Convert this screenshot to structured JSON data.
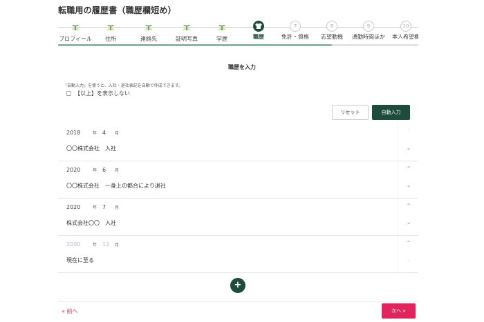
{
  "header": {
    "title": "転職用の履歴書（職歴欄短め）"
  },
  "stepper": {
    "progress": 0.76,
    "steps": [
      {
        "label": "プロフィール",
        "state": "done"
      },
      {
        "label": "住所",
        "state": "done"
      },
      {
        "label": "連絡先",
        "state": "done"
      },
      {
        "label": "証明写真",
        "state": "done"
      },
      {
        "label": "学歴",
        "state": "done"
      },
      {
        "label": "職歴",
        "state": "active"
      },
      {
        "label": "免許・資格",
        "number": "7",
        "state": "todo"
      },
      {
        "label": "志望動機",
        "number": "8",
        "state": "todo"
      },
      {
        "label": "通勤時間ほか",
        "number": "9",
        "state": "todo"
      },
      {
        "label": "本人希望欄",
        "number": "10",
        "state": "todo"
      }
    ]
  },
  "main": {
    "section_title": "職歴を入力",
    "hint": "「自動入力」を使うと、入社・退社表記を自動で作成できます。",
    "checkbox_label": "【以上】を表示しない",
    "reset_label": "リセット",
    "auto_label": "自動入力",
    "year_unit": "年",
    "month_unit": "月",
    "entries": [
      {
        "year": "2018",
        "month": "4",
        "text": "〇〇株式会社　入社"
      },
      {
        "year": "2020",
        "month": "6",
        "text": "〇〇株式会社　一身上の都合により退社"
      },
      {
        "year": "2020",
        "month": "7",
        "text": "株式会社〇〇　入社"
      },
      {
        "year": "2000",
        "month": "12",
        "text": "現在に至る"
      }
    ],
    "add_icon": "+"
  },
  "footer": {
    "prev_label": "« 前へ",
    "next_label": "次へ »"
  },
  "colors": {
    "primary": "#1e4b3c",
    "accent": "#e0245e"
  }
}
